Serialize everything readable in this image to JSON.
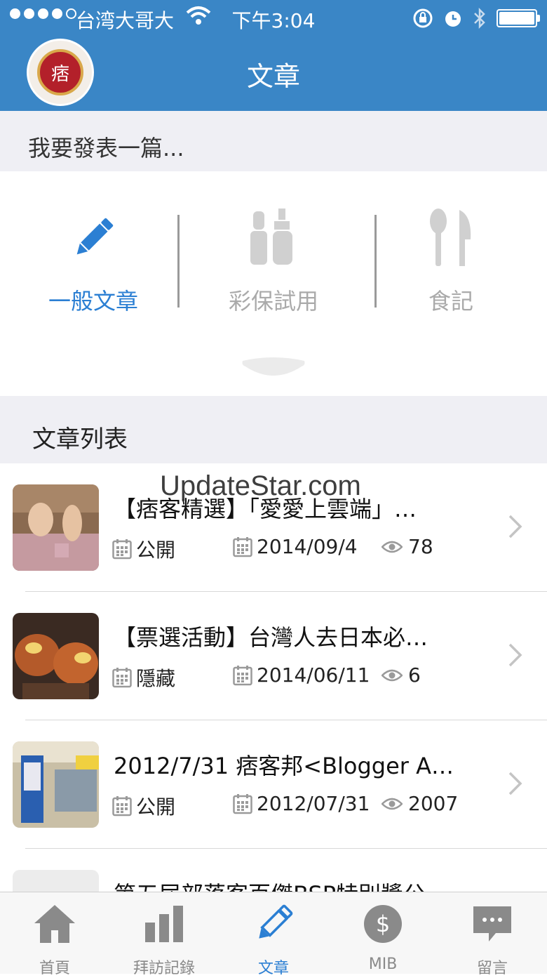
{
  "status_bar": {
    "carrier": "台湾大哥大",
    "time": "下午3:04",
    "signal_bars": 4,
    "signal_max": 5
  },
  "nav": {
    "title": "文章",
    "avatar_text": "痞"
  },
  "compose": {
    "heading": "我要發表一篇...",
    "options": [
      {
        "label": "一般文章",
        "icon": "pencil-icon",
        "active": true
      },
      {
        "label": "彩保試用",
        "icon": "cosmetics-icon",
        "active": false
      },
      {
        "label": "食記",
        "icon": "utensils-icon",
        "active": false
      }
    ]
  },
  "list": {
    "heading": "文章列表",
    "items": [
      {
        "title": "【痞客精選】「愛愛上雲端」…",
        "visibility": "公開",
        "date": "2014/09/4",
        "views": "78"
      },
      {
        "title": "【票選活動】台灣人去日本必…",
        "visibility": "隱藏",
        "date": "2014/06/11",
        "views": "6"
      },
      {
        "title": "2012/7/31 痞客邦<Blogger A…",
        "visibility": "公開",
        "date": "2012/07/31",
        "views": "2007"
      },
      {
        "title": "第五屆部落客百傑BSP特別獎公…"
      }
    ]
  },
  "watermark": "UpdateStar.com",
  "tab_bar": {
    "tabs": [
      {
        "label": "首頁",
        "icon": "home-icon"
      },
      {
        "label": "拜訪記錄",
        "icon": "bar-chart-icon"
      },
      {
        "label": "文章",
        "icon": "pencil-icon",
        "active": true
      },
      {
        "label": "MIB",
        "icon": "dollar-icon"
      },
      {
        "label": "留言",
        "icon": "message-icon"
      }
    ]
  },
  "colors": {
    "header": "#3a86c6",
    "accent": "#2b7fd3",
    "section_bg": "#efeff4",
    "inactive": "#aaaaaa"
  }
}
